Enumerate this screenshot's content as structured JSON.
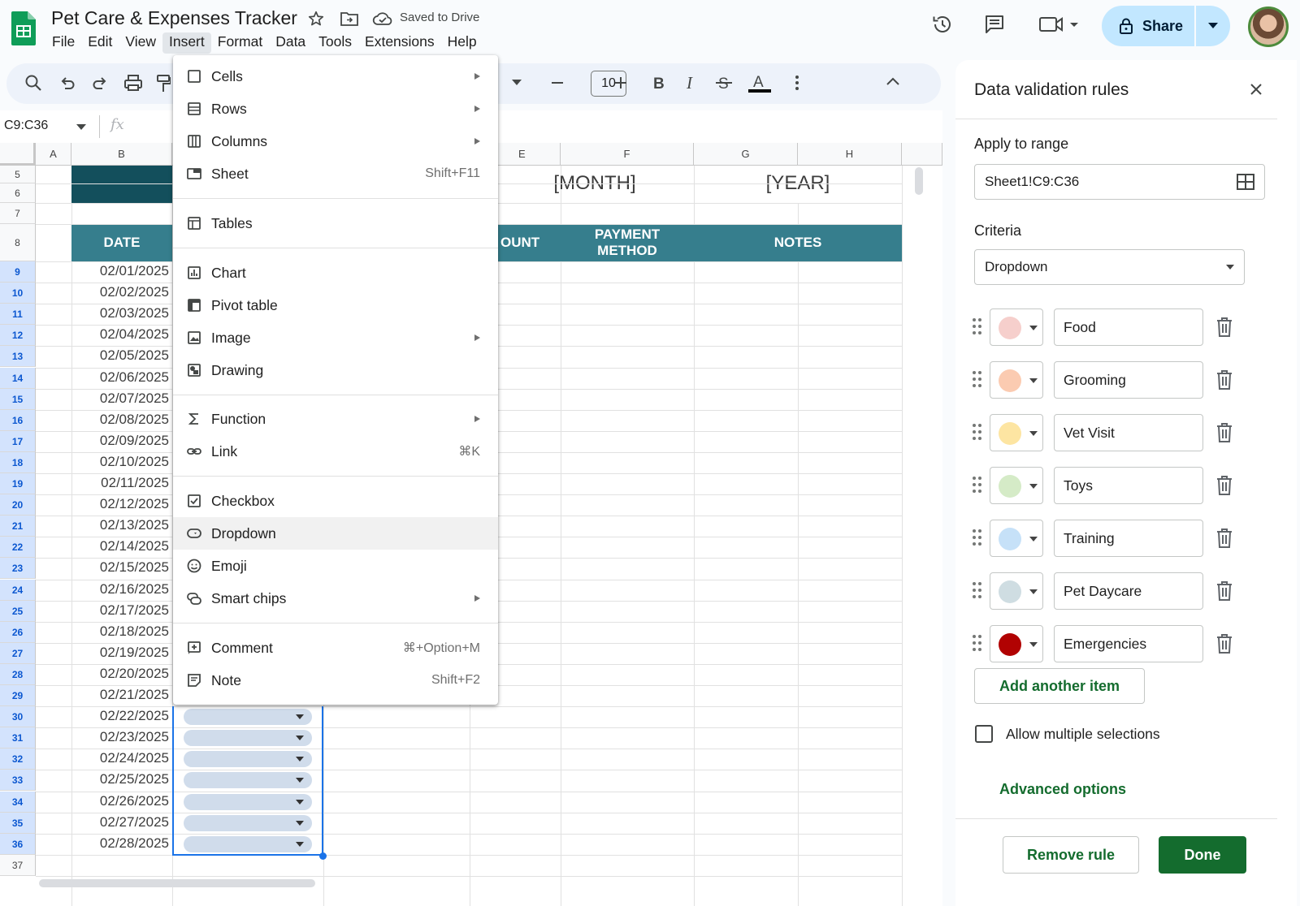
{
  "app": {
    "title": "Pet Care & Expenses Tracker",
    "save_status": "Saved to Drive",
    "menu": [
      "File",
      "Edit",
      "View",
      "Insert",
      "Format",
      "Data",
      "Tools",
      "Extensions",
      "Help"
    ],
    "active_menu": "Insert",
    "share_label": "Share",
    "accent_color": "#0f9d58"
  },
  "toolbar": {
    "font_size": "10"
  },
  "formula_bar": {
    "name_box": "C9:C36",
    "fx": "fx"
  },
  "grid": {
    "columns": [
      "A",
      "B",
      "E",
      "F",
      "G",
      "H"
    ],
    "header_labels": {
      "date": "DATE",
      "amount": "OUNT",
      "payment": "PAYMENT METHOD",
      "notes": "NOTES"
    },
    "month_label": "[MONTH]",
    "year_label": "[YEAR]",
    "rows": [
      "5",
      "6",
      "7",
      "8",
      "9",
      "10",
      "11",
      "12",
      "13",
      "14",
      "15",
      "16",
      "17",
      "18",
      "19",
      "20",
      "21",
      "22",
      "23",
      "24",
      "25",
      "26",
      "27",
      "28",
      "29",
      "30",
      "31",
      "32",
      "33",
      "34",
      "35",
      "36",
      "37"
    ],
    "dates": [
      "02/01/2025",
      "02/02/2025",
      "02/03/2025",
      "02/04/2025",
      "02/05/2025",
      "02/06/2025",
      "02/07/2025",
      "02/08/2025",
      "02/09/2025",
      "02/10/2025",
      "02/11/2025",
      "02/12/2025",
      "02/13/2025",
      "02/14/2025",
      "02/15/2025",
      "02/16/2025",
      "02/17/2025",
      "02/18/2025",
      "02/19/2025",
      "02/20/2025",
      "02/21/2025",
      "02/22/2025",
      "02/23/2025",
      "02/24/2025",
      "02/25/2025",
      "02/26/2025",
      "02/27/2025",
      "02/28/2025"
    ],
    "header_color": "#367e8d",
    "title_band_color": "#134f5c"
  },
  "insert_menu": {
    "items": [
      {
        "label": "Cells",
        "shortcut": "",
        "submenu": true,
        "icon": "cells-icon"
      },
      {
        "label": "Rows",
        "shortcut": "",
        "submenu": true,
        "icon": "rows-icon"
      },
      {
        "label": "Columns",
        "shortcut": "",
        "submenu": true,
        "icon": "columns-icon"
      },
      {
        "label": "Sheet",
        "shortcut": "Shift+F11",
        "submenu": false,
        "icon": "sheet-icon"
      },
      {
        "label": "Tables",
        "shortcut": "",
        "submenu": false,
        "icon": "tables-icon"
      },
      {
        "label": "Chart",
        "shortcut": "",
        "submenu": false,
        "icon": "chart-icon"
      },
      {
        "label": "Pivot table",
        "shortcut": "",
        "submenu": false,
        "icon": "pivot-icon"
      },
      {
        "label": "Image",
        "shortcut": "",
        "submenu": true,
        "icon": "image-icon"
      },
      {
        "label": "Drawing",
        "shortcut": "",
        "submenu": false,
        "icon": "drawing-icon"
      },
      {
        "label": "Function",
        "shortcut": "",
        "submenu": true,
        "icon": "sigma-icon"
      },
      {
        "label": "Link",
        "shortcut": "⌘K",
        "submenu": false,
        "icon": "link-icon"
      },
      {
        "label": "Checkbox",
        "shortcut": "",
        "submenu": false,
        "icon": "checkbox-icon"
      },
      {
        "label": "Dropdown",
        "shortcut": "",
        "submenu": false,
        "icon": "dropdown-icon"
      },
      {
        "label": "Emoji",
        "shortcut": "",
        "submenu": false,
        "icon": "emoji-icon"
      },
      {
        "label": "Smart chips",
        "shortcut": "",
        "submenu": true,
        "icon": "smart-chips-icon"
      },
      {
        "label": "Comment",
        "shortcut": "⌘+Option+M",
        "submenu": false,
        "icon": "comment-icon"
      },
      {
        "label": "Note",
        "shortcut": "Shift+F2",
        "submenu": false,
        "icon": "note-icon"
      }
    ],
    "highlighted": "Dropdown"
  },
  "panel": {
    "title": "Data validation rules",
    "apply_label": "Apply to range",
    "range": "Sheet1!C9:C36",
    "criteria_label": "Criteria",
    "criteria": "Dropdown",
    "options": [
      {
        "label": "Food",
        "color": "#f6cfcc"
      },
      {
        "label": "Grooming",
        "color": "#fbcbb1"
      },
      {
        "label": "Vet Visit",
        "color": "#fde5a2"
      },
      {
        "label": "Toys",
        "color": "#d5ebc7"
      },
      {
        "label": "Training",
        "color": "#c6e1f8"
      },
      {
        "label": "Pet Daycare",
        "color": "#cfdde2"
      },
      {
        "label": "Emergencies",
        "color": "#b10202"
      }
    ],
    "add_item": "Add another item",
    "multi_label": "Allow multiple selections",
    "advanced": "Advanced options",
    "remove": "Remove rule",
    "done": "Done"
  }
}
